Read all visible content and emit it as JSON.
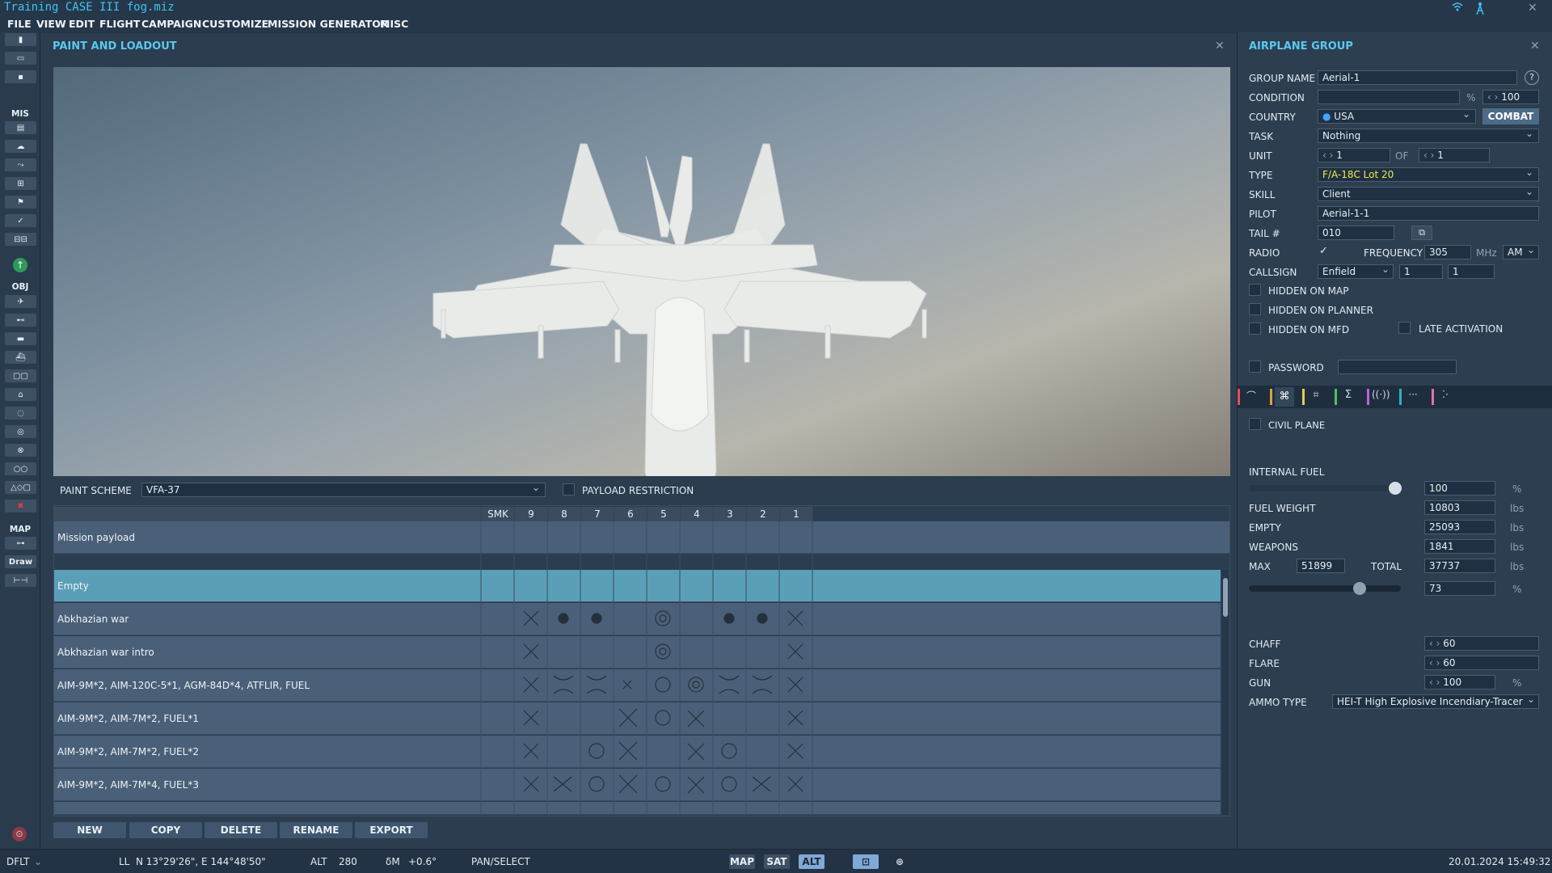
{
  "window": {
    "title": "Training CASE III fog.miz"
  },
  "menu": [
    "FILE",
    "VIEW",
    "EDIT",
    "FLIGHT",
    "CAMPAIGN",
    "CUSTOMIZE",
    "MISSION GENERATOR",
    "MISC"
  ],
  "toolbar": {
    "sections": {
      "mis": "MIS",
      "obj": "OBJ",
      "map": "MAP"
    },
    "draw_label": "Draw"
  },
  "paint_panel": {
    "title": "PAINT AND LOADOUT",
    "paint_scheme_label": "PAINT SCHEME",
    "paint_scheme_value": "VFA-37",
    "payload_restriction_label": "PAYLOAD RESTRICTION",
    "columns": [
      "SMK",
      "9",
      "8",
      "7",
      "6",
      "5",
      "4",
      "3",
      "2",
      "1"
    ],
    "mission_payload_label": "Mission payload",
    "rows": [
      {
        "name": "Empty"
      },
      {
        "name": "Abkhazian war"
      },
      {
        "name": "Abkhazian war intro"
      },
      {
        "name": "AIM-9M*2, AIM-120C-5*1, AGM-84D*4, ATFLIR, FUEL"
      },
      {
        "name": "AIM-9M*2, AIM-7M*2, FUEL*1"
      },
      {
        "name": "AIM-9M*2, AIM-7M*2, FUEL*2"
      },
      {
        "name": "AIM-9M*2, AIM-7M*4, FUEL*3"
      }
    ],
    "buttons": [
      "NEW",
      "COPY",
      "DELETE",
      "RENAME",
      "EXPORT"
    ]
  },
  "group_panel": {
    "title": "AIRPLANE GROUP",
    "group_name_label": "GROUP NAME",
    "group_name": "Aerial-1",
    "help": "?",
    "condition_label": "CONDITION",
    "condition_unit": "%",
    "condition_value": "100",
    "country_label": "COUNTRY",
    "country": "USA",
    "combat_button": "COMBAT",
    "task_label": "TASK",
    "task": "Nothing",
    "unit_label": "UNIT",
    "unit_value": "1",
    "of_label": "OF",
    "of_value": "1",
    "type_label": "TYPE",
    "type": "F/A-18C Lot 20",
    "skill_label": "SKILL",
    "skill": "Client",
    "pilot_label": "PILOT",
    "pilot": "Aerial-1-1",
    "tail_label": "TAIL #",
    "tail": "010",
    "radio_label": "RADIO",
    "frequency_label": "FREQUENCY",
    "frequency": "305",
    "mhz": "MHz",
    "modulation": "AM",
    "callsign_label": "CALLSIGN",
    "callsign": "Enfield",
    "callsign_n1": "1",
    "callsign_n2": "1",
    "hidden_map": "HIDDEN ON MAP",
    "hidden_planner": "HIDDEN ON PLANNER",
    "hidden_mfd": "HIDDEN ON MFD",
    "late_activation": "LATE ACTIVATION",
    "password": "PASSWORD",
    "civil_plane": "CIVIL PLANE",
    "internal_fuel_label": "INTERNAL FUEL",
    "internal_fuel": "100",
    "internal_fuel_level": 0.98,
    "fuel_weight_label": "FUEL WEIGHT",
    "fuel_weight": "10803",
    "empty_label": "EMPTY",
    "empty": "25093",
    "weapons_label": "WEAPONS",
    "weapons": "1841",
    "max_label": "MAX",
    "max": "51899",
    "total_label": "TOTAL",
    "total": "37737",
    "total_pct": "73",
    "total_level": 0.73,
    "lbs": "lbs",
    "pct": "%",
    "chaff_label": "CHAFF",
    "chaff": "60",
    "flare_label": "FLARE",
    "flare": "60",
    "gun_label": "GUN",
    "gun": "100",
    "ammo_label": "AMMO TYPE",
    "ammo": "HEI-T High Explosive Incendiary-Tracer"
  },
  "status": {
    "profile": "DFLT",
    "ll_label": "LL",
    "coords": "N 13°29'26\", E 144°48'50\"",
    "alt_label": "ALT",
    "alt": "280",
    "dm_label": "δM",
    "dm": "+0.6°",
    "mode": "PAN/SELECT",
    "map_btn": "MAP",
    "sat_btn": "SAT",
    "alt_btn": "ALT",
    "datetime": "20.01.2024 15:49:32"
  },
  "colors": {
    "accent": "#59c8f0",
    "selected_row": "#5b9eb7",
    "type_text": "#f1e84a"
  }
}
